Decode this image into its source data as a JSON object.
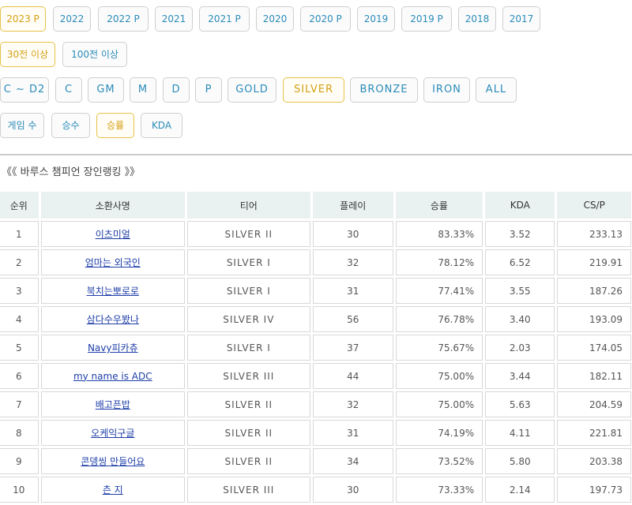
{
  "filters": {
    "years": [
      "2023 P",
      "2022",
      "2022 P",
      "2021",
      "2021 P",
      "2020",
      "2020 P",
      "2019",
      "2019 P",
      "2018",
      "2017"
    ],
    "games": [
      "30전 이상",
      "100전 이상"
    ],
    "tiers": [
      "C ~ D2",
      "C",
      "GM",
      "M",
      "D",
      "P",
      "GOLD",
      "SILVER",
      "BRONZE",
      "IRON",
      "ALL"
    ],
    "sort": [
      "게임 수",
      "승수",
      "승률",
      "KDA"
    ]
  },
  "heading": "《《 바루스 챔피언 장인랭킹 》》",
  "table": {
    "headers": [
      "순위",
      "소환사명",
      "티어",
      "플레이",
      "승률",
      "KDA",
      "CS/P"
    ],
    "rows": [
      [
        "1",
        "이츠미얼",
        "SILVER II",
        "30",
        "83.33%",
        "3.52",
        "233.13"
      ],
      [
        "2",
        "엄마는 외국인",
        "SILVER I",
        "32",
        "78.12%",
        "6.52",
        "219.91"
      ],
      [
        "3",
        "북치는뽀로로",
        "SILVER I",
        "31",
        "77.41%",
        "3.55",
        "187.26"
      ],
      [
        "4",
        "삼다수우봤나",
        "SILVER IV",
        "56",
        "76.78%",
        "3.40",
        "193.09"
      ],
      [
        "5",
        "Navy피카츄",
        "SILVER I",
        "37",
        "75.67%",
        "2.03",
        "174.05"
      ],
      [
        "6",
        "my name is ADC",
        "SILVER III",
        "44",
        "75.00%",
        "3.44",
        "182.11"
      ],
      [
        "7",
        "배고픈밥",
        "SILVER II",
        "32",
        "75.00%",
        "5.63",
        "204.59"
      ],
      [
        "8",
        "오케익구글",
        "SILVER II",
        "31",
        "74.19%",
        "4.11",
        "221.81"
      ],
      [
        "9",
        "콘뎅씽 만들어요",
        "SILVER II",
        "34",
        "73.52%",
        "5.80",
        "203.38"
      ],
      [
        "10",
        "츤 지",
        "SILVER III",
        "30",
        "73.33%",
        "2.14",
        "197.73"
      ]
    ]
  },
  "colors": {
    "accent": "#2a8bb8",
    "active": "#d4a017",
    "header_bg": "#e9f2f1",
    "link": "#1e3ea8"
  }
}
